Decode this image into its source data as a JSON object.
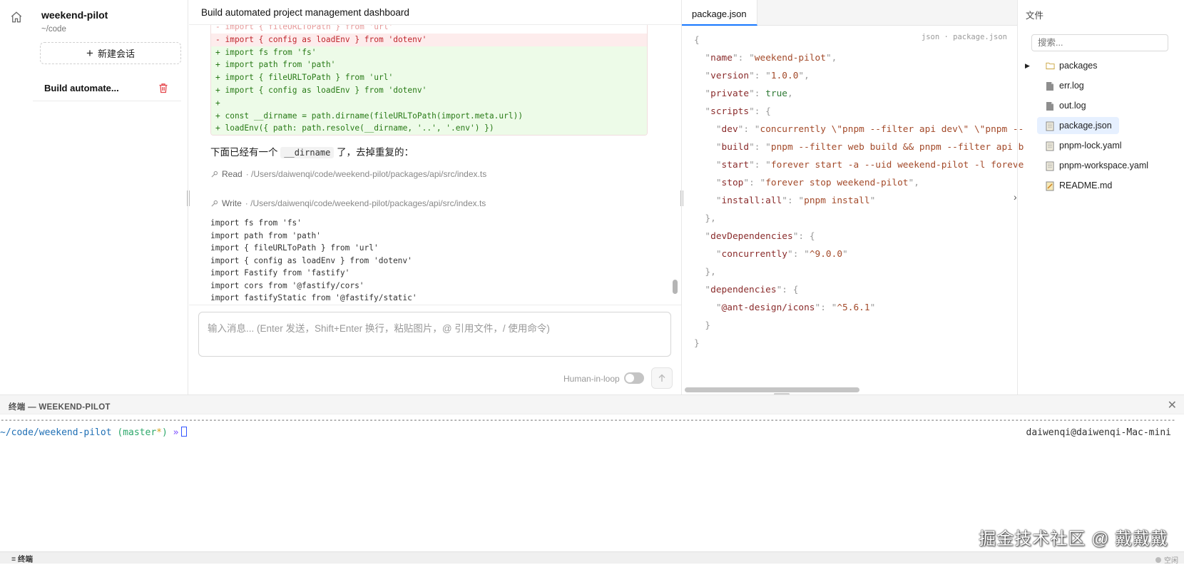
{
  "sidebar": {
    "project_name": "weekend-pilot",
    "project_path": "~/code",
    "new_chat_label": "新建会话",
    "sessions": [
      {
        "title": "Build automate..."
      }
    ]
  },
  "chat": {
    "title": "Build automated project management dashboard",
    "diff_lines": [
      {
        "type": "sub",
        "text": "- import { fileURLToPath } from 'url'"
      },
      {
        "type": "del",
        "text": "- import { config as loadEnv } from 'dotenv'"
      },
      {
        "type": "add",
        "text": "+ import fs from 'fs'"
      },
      {
        "type": "add",
        "text": "+ import path from 'path'"
      },
      {
        "type": "add",
        "text": "+ import { fileURLToPath } from 'url'"
      },
      {
        "type": "add",
        "text": "+ import { config as loadEnv } from 'dotenv'"
      },
      {
        "type": "add",
        "text": "+"
      },
      {
        "type": "add",
        "text": "+ const __dirname = path.dirname(fileURLToPath(import.meta.url))"
      },
      {
        "type": "add",
        "text": "+ loadEnv({ path: path.resolve(__dirname, '..', '.env') })"
      }
    ],
    "message_before": "下面已经有一个",
    "message_code": "__dirname",
    "message_after": "了，去掉重复的：",
    "tool_read": {
      "name": "Read",
      "path": "· /Users/daiwenqi/code/weekend-pilot/packages/api/src/index.ts"
    },
    "tool_write": {
      "name": "Write",
      "path": "· /Users/daiwenqi/code/weekend-pilot/packages/api/src/index.ts"
    },
    "code_lines": [
      "import fs from 'fs'",
      "import path from 'path'",
      "import { fileURLToPath } from 'url'",
      "import { config as loadEnv } from 'dotenv'",
      "import Fastify from 'fastify'",
      "import cors from '@fastify/cors'",
      "import fastifyStatic from '@fastify/static'"
    ],
    "input_placeholder": "输入消息... (Enter 发送，Shift+Enter 换行，粘贴图片，@ 引用文件，/ 使用命令)",
    "human_in_loop_label": "Human-in-loop",
    "human_in_loop_on": false
  },
  "editor": {
    "tab_label": "package.json",
    "meta": "json · package.json",
    "lines": [
      [
        {
          "c": "q",
          "t": "{"
        }
      ],
      [
        {
          "c": "q",
          "t": "  \""
        },
        {
          "c": "k",
          "t": "name"
        },
        {
          "c": "q",
          "t": "\": \""
        },
        {
          "c": "s",
          "t": "weekend-pilot"
        },
        {
          "c": "q",
          "t": "\","
        }
      ],
      [
        {
          "c": "q",
          "t": "  \""
        },
        {
          "c": "k",
          "t": "version"
        },
        {
          "c": "q",
          "t": "\": \""
        },
        {
          "c": "s",
          "t": "1.0.0"
        },
        {
          "c": "q",
          "t": "\","
        }
      ],
      [
        {
          "c": "q",
          "t": "  \""
        },
        {
          "c": "k",
          "t": "private"
        },
        {
          "c": "q",
          "t": "\": "
        },
        {
          "c": "b",
          "t": "true"
        },
        {
          "c": "q",
          "t": ","
        }
      ],
      [
        {
          "c": "q",
          "t": "  \""
        },
        {
          "c": "k",
          "t": "scripts"
        },
        {
          "c": "q",
          "t": "\": {"
        }
      ],
      [
        {
          "c": "q",
          "t": "    \""
        },
        {
          "c": "k",
          "t": "dev"
        },
        {
          "c": "q",
          "t": "\": \""
        },
        {
          "c": "s",
          "t": "concurrently \\\"pnpm --filter api dev\\\" \\\"pnpm --"
        }
      ],
      [
        {
          "c": "q",
          "t": "    \""
        },
        {
          "c": "k",
          "t": "build"
        },
        {
          "c": "q",
          "t": "\": \""
        },
        {
          "c": "s",
          "t": "pnpm --filter web build && pnpm --filter api b"
        }
      ],
      [
        {
          "c": "q",
          "t": "    \""
        },
        {
          "c": "k",
          "t": "start"
        },
        {
          "c": "q",
          "t": "\": \""
        },
        {
          "c": "s",
          "t": "forever start -a --uid weekend-pilot -l foreve"
        }
      ],
      [
        {
          "c": "q",
          "t": "    \""
        },
        {
          "c": "k",
          "t": "stop"
        },
        {
          "c": "q",
          "t": "\": \""
        },
        {
          "c": "s",
          "t": "forever stop weekend-pilot"
        },
        {
          "c": "q",
          "t": "\","
        }
      ],
      [
        {
          "c": "q",
          "t": "    \""
        },
        {
          "c": "k",
          "t": "install:all"
        },
        {
          "c": "q",
          "t": "\": \""
        },
        {
          "c": "s",
          "t": "pnpm install"
        },
        {
          "c": "q",
          "t": "\""
        }
      ],
      [
        {
          "c": "q",
          "t": "  },"
        }
      ],
      [
        {
          "c": "q",
          "t": "  \""
        },
        {
          "c": "k",
          "t": "devDependencies"
        },
        {
          "c": "q",
          "t": "\": {"
        }
      ],
      [
        {
          "c": "q",
          "t": "    \""
        },
        {
          "c": "k",
          "t": "concurrently"
        },
        {
          "c": "q",
          "t": "\": \""
        },
        {
          "c": "s",
          "t": "^9.0.0"
        },
        {
          "c": "q",
          "t": "\""
        }
      ],
      [
        {
          "c": "q",
          "t": "  },"
        }
      ],
      [
        {
          "c": "q",
          "t": "  \""
        },
        {
          "c": "k",
          "t": "dependencies"
        },
        {
          "c": "q",
          "t": "\": {"
        }
      ],
      [
        {
          "c": "q",
          "t": "    \""
        },
        {
          "c": "k",
          "t": "@ant-design/icons"
        },
        {
          "c": "q",
          "t": "\": \""
        },
        {
          "c": "s",
          "t": "^5.6.1"
        },
        {
          "c": "q",
          "t": "\""
        }
      ],
      [
        {
          "c": "q",
          "t": "  }"
        }
      ],
      [
        {
          "c": "q",
          "t": "}"
        }
      ]
    ]
  },
  "files": {
    "title": "文件",
    "search_placeholder": "搜索...",
    "items": [
      {
        "name": "packages",
        "kind": "folder",
        "icon": "folder-icon",
        "selected": false
      },
      {
        "name": "err.log",
        "kind": "file",
        "icon": "file-icon",
        "selected": false
      },
      {
        "name": "out.log",
        "kind": "file",
        "icon": "file-icon",
        "selected": false
      },
      {
        "name": "package.json",
        "kind": "file",
        "icon": "json-file-icon",
        "selected": true
      },
      {
        "name": "pnpm-lock.yaml",
        "kind": "file",
        "icon": "yaml-file-icon",
        "selected": false
      },
      {
        "name": "pnpm-workspace.yaml",
        "kind": "file",
        "icon": "yaml-file-icon",
        "selected": false
      },
      {
        "name": "README.md",
        "kind": "file",
        "icon": "markdown-file-icon",
        "selected": false
      }
    ]
  },
  "terminal": {
    "title": "终端 — WEEKEND-PILOT",
    "prompt_path": "~/code/weekend-pilot",
    "prompt_branch_open": " (",
    "prompt_branch": "master",
    "prompt_star": "*",
    "prompt_branch_close": ")",
    "prompt_arrow": " »",
    "host": "daiwenqi@daiwenqi-Mac-mini"
  },
  "watermark": "掘金技术社区 @ 戴戴戴",
  "statusbar": {
    "terminal_label": "≡ 终端",
    "status": "空闲"
  },
  "colors": {
    "accent": "#1677ff",
    "diff_add_bg": "#edfbe8",
    "diff_del_bg": "#fdecec",
    "delete_red": "#e5484d"
  }
}
